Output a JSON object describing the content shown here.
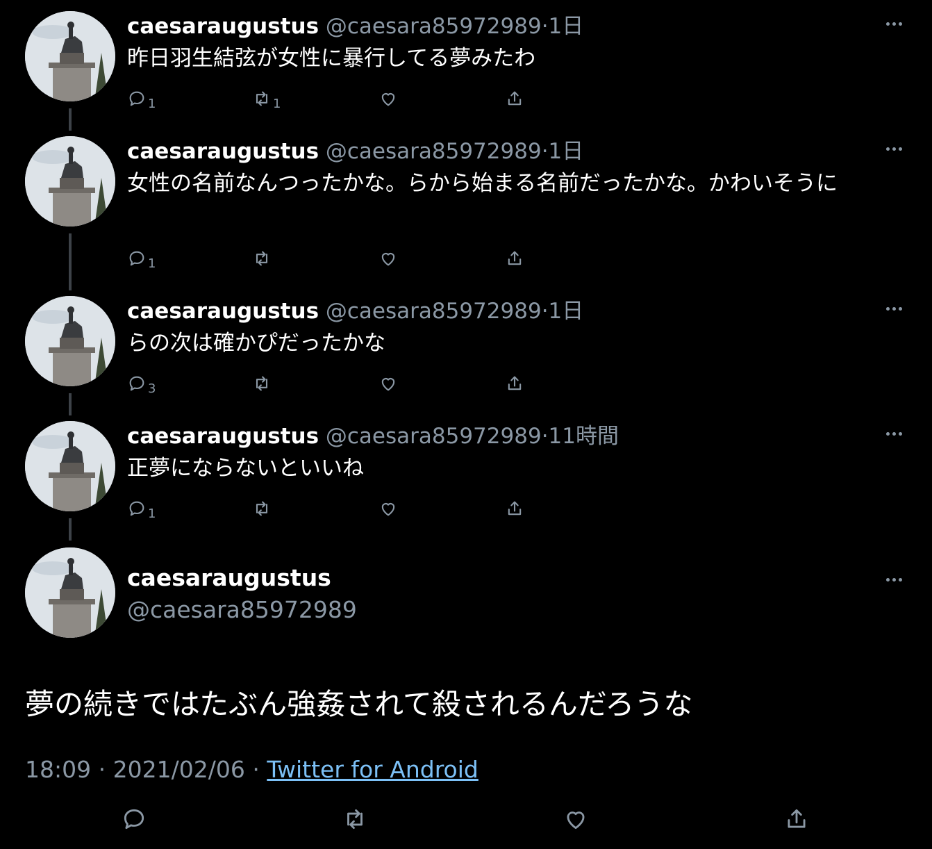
{
  "tweets": [
    {
      "name": "caesaraugustus",
      "handle": "@caesara85972989",
      "sep": "·",
      "time": "1日",
      "text": "昨日羽生結弦が女性に暴行してる夢みたわ",
      "reply": "1",
      "retweet": "1",
      "like": "",
      "share": ""
    },
    {
      "name": "caesaraugustus",
      "handle": "@caesara85972989",
      "sep": "·",
      "time": "1日",
      "text": "女性の名前なんつったかな。らから始まる名前だったかな。かわいそうに",
      "reply": "1",
      "retweet": "",
      "like": "",
      "share": ""
    },
    {
      "name": "caesaraugustus",
      "handle": "@caesara85972989",
      "sep": "·",
      "time": "1日",
      "text": "らの次は確かぴだったかな",
      "reply": "3",
      "retweet": "",
      "like": "",
      "share": ""
    },
    {
      "name": "caesaraugustus",
      "handle": "@caesara85972989",
      "sep": "·",
      "time": "11時間",
      "text": "正夢にならないといいね",
      "reply": "1",
      "retweet": "",
      "like": "",
      "share": ""
    }
  ],
  "main_tweet": {
    "name": "caesaraugustus",
    "handle": "@caesara85972989",
    "text": "夢の続きではたぶん強姦されて殺されるんだろうな",
    "time": "18:09",
    "date": "2021/02/06",
    "sep": "·",
    "source": "Twitter for Android"
  },
  "icons": {
    "reply": "reply-icon",
    "retweet": "retweet-icon",
    "like": "heart-icon",
    "share": "share-icon",
    "more": "more-icon"
  },
  "colors": {
    "background": "#000000",
    "secondary_text": "#8b98a5",
    "link": "#7cc0f6",
    "text": "#ffffff"
  }
}
